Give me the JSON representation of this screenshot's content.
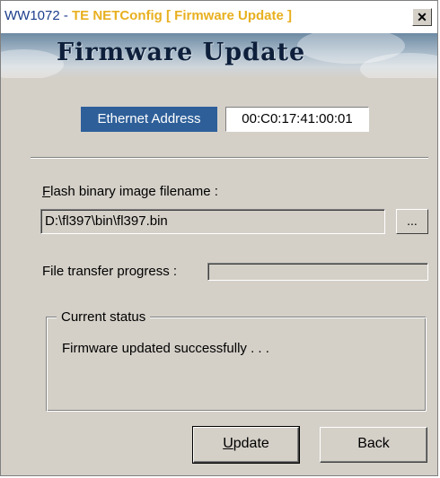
{
  "window": {
    "title_prefix": "WW1072 - ",
    "title_main": "TE NETConfig [ Firmware Update ]",
    "close_glyph": "✕"
  },
  "banner": {
    "title": "Firmware Update"
  },
  "ethernet": {
    "label": "Ethernet Address",
    "value": "00:C0:17:41:00:01"
  },
  "flash": {
    "label_mnemonic": "F",
    "label_rest": "lash binary image filename :",
    "value": "D:\\fl397\\bin\\fl397.bin",
    "browse_label": "..."
  },
  "progress": {
    "label": "File transfer progress :",
    "value": 0
  },
  "status": {
    "group_title": "Current status",
    "message": "Firmware updated successfully . . ."
  },
  "buttons": {
    "update_mnemonic": "U",
    "update_rest": "pdate",
    "back_label": "Back"
  }
}
